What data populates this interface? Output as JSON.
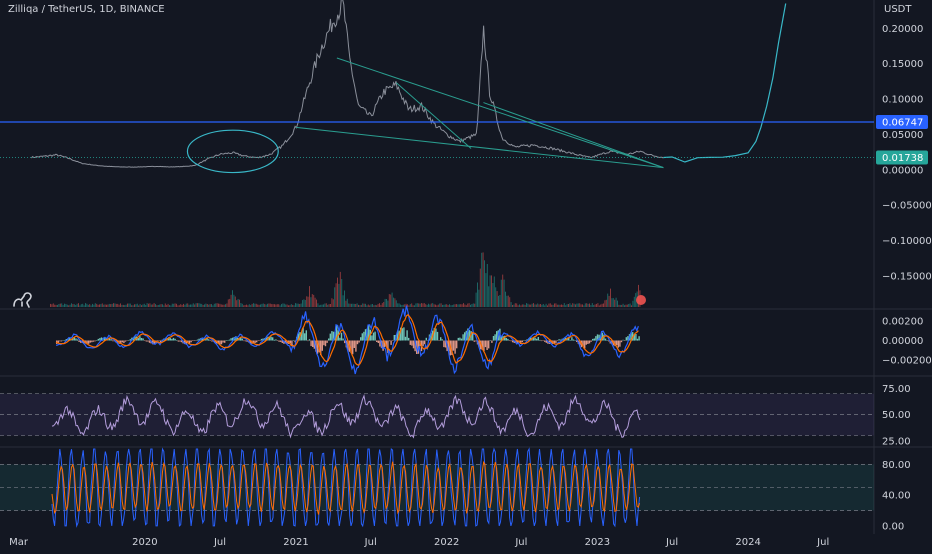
{
  "header": {
    "symbol_title": "Zilliqa / TetherUS, 1D, BINANCE",
    "price_unit": "USDT"
  },
  "colors": {
    "background": "#131722",
    "grid": "#1e222d",
    "axis_text": "#d1d4dc",
    "price_line": "#8a8f9a",
    "projection": "#39b8c8",
    "horizontal_level": "#2962ff",
    "trendline": "#2a9d8f",
    "circle": "#39b8c8",
    "volume_up": "#26a69a",
    "volume_down": "#ef5350",
    "macd_pos": "#7ad8c8",
    "macd_neg": "#f2a391",
    "macd_line": "#2962ff",
    "signal_line": "#ff6d00",
    "rsi_line": "#b39ddb",
    "rsi_band": "#7e57c2",
    "stoch_k": "#2962ff",
    "stoch_d": "#ff6d00",
    "stoch_band": "#26a69a",
    "level_label_bg": "#2962ff",
    "last_label_bg": "#26a69a"
  },
  "chart_data": {
    "type": "line",
    "x_axis": {
      "ticks": [
        "Mar",
        "2020",
        "Jul",
        "2021",
        "Jul",
        "2022",
        "Jul",
        "2023",
        "Jul",
        "2024",
        "Jul"
      ],
      "tick_dates": [
        "2019-03-01",
        "2020-01-01",
        "2020-07-01",
        "2021-01-01",
        "2021-07-01",
        "2022-01-01",
        "2022-07-01",
        "2023-01-01",
        "2023-07-01",
        "2024-01-01",
        "2024-07-01"
      ],
      "range": [
        "2019-01-15",
        "2024-11-01"
      ]
    },
    "price_panel": {
      "y_ticks": [
        "0.20000",
        "0.15000",
        "0.10000",
        "0.05000",
        "0.00000",
        "−0.05000",
        "−0.10000",
        "−0.15000"
      ],
      "y_tick_values": [
        0.2,
        0.15,
        0.1,
        0.05,
        0.0,
        -0.05,
        -0.1,
        -0.15
      ],
      "ylim": [
        -0.17,
        0.24
      ],
      "grid": false,
      "series": [
        {
          "values": [
            [
              "2019-04-01",
              0.0175
            ],
            [
              "2019-05-01",
              0.019
            ],
            [
              "2019-06-01",
              0.021
            ],
            [
              "2019-07-01",
              0.016
            ],
            [
              "2019-08-01",
              0.009
            ],
            [
              "2019-09-01",
              0.0065
            ],
            [
              "2019-10-01",
              0.0048
            ],
            [
              "2019-11-01",
              0.004
            ],
            [
              "2019-12-01",
              0.0038
            ],
            [
              "2020-01-01",
              0.0042
            ],
            [
              "2020-02-01",
              0.0048
            ],
            [
              "2020-03-01",
              0.004
            ],
            [
              "2020-04-01",
              0.0045
            ],
            [
              "2020-05-01",
              0.006
            ],
            [
              "2020-06-01",
              0.015
            ],
            [
              "2020-07-01",
              0.022
            ],
            [
              "2020-08-01",
              0.024
            ],
            [
              "2020-09-01",
              0.019
            ],
            [
              "2020-10-01",
              0.017
            ],
            [
              "2020-11-01",
              0.022
            ],
            [
              "2020-12-01",
              0.035
            ],
            [
              "2021-01-01",
              0.06
            ],
            [
              "2021-02-01",
              0.12
            ],
            [
              "2021-03-01",
              0.17
            ],
            [
              "2021-04-01",
              0.21
            ],
            [
              "2021-04-25",
              0.235
            ],
            [
              "2021-05-10",
              0.16
            ],
            [
              "2021-06-01",
              0.09
            ],
            [
              "2021-07-01",
              0.075
            ],
            [
              "2021-08-01",
              0.11
            ],
            [
              "2021-09-01",
              0.12
            ],
            [
              "2021-10-01",
              0.085
            ],
            [
              "2021-11-01",
              0.09
            ],
            [
              "2021-12-01",
              0.065
            ],
            [
              "2022-01-01",
              0.05
            ],
            [
              "2022-02-01",
              0.04
            ],
            [
              "2022-03-15",
              0.05
            ],
            [
              "2022-03-31",
              0.2
            ],
            [
              "2022-04-15",
              0.11
            ],
            [
              "2022-05-15",
              0.045
            ],
            [
              "2022-06-15",
              0.032
            ],
            [
              "2022-08-01",
              0.035
            ],
            [
              "2022-09-15",
              0.03
            ],
            [
              "2022-11-15",
              0.021
            ],
            [
              "2022-12-15",
              0.017
            ],
            [
              "2023-02-01",
              0.026
            ],
            [
              "2023-03-15",
              0.022
            ],
            [
              "2023-04-15",
              0.026
            ],
            [
              "2023-05-15",
              0.02
            ],
            [
              "2023-06-10",
              0.01738
            ]
          ]
        },
        {
          "values": [
            [
              "2023-06-10",
              0.01738
            ],
            [
              "2023-07-01",
              0.018
            ],
            [
              "2023-08-01",
              0.011
            ],
            [
              "2023-09-01",
              0.017
            ],
            [
              "2023-10-01",
              0.0175
            ],
            [
              "2023-11-01",
              0.0178
            ],
            [
              "2023-12-01",
              0.02
            ],
            [
              "2024-01-01",
              0.024
            ],
            [
              "2024-01-20",
              0.04
            ],
            [
              "2024-02-01",
              0.06
            ],
            [
              "2024-02-15",
              0.09
            ],
            [
              "2024-03-01",
              0.13
            ],
            [
              "2024-03-15",
              0.18
            ],
            [
              "2024-04-01",
              0.235
            ]
          ]
        }
      ],
      "horizontal_level": 0.06747,
      "price_labels": [
        "0.06747",
        "0.01738"
      ],
      "trendlines": [
        {
          "from": [
            "2021-04-10",
            0.158
          ],
          "to": [
            "2023-06-10",
            0.003
          ]
        },
        {
          "from": [
            "2021-01-01",
            0.06
          ],
          "to": [
            "2023-06-10",
            0.003
          ]
        },
        {
          "from": [
            "2022-03-31",
            0.095
          ],
          "to": [
            "2023-06-10",
            0.003
          ]
        },
        {
          "from": [
            "2021-09-01",
            0.123
          ],
          "to": [
            "2022-03-01",
            0.03
          ]
        }
      ],
      "ellipse": {
        "center": [
          "2020-08-01",
          0.026
        ],
        "rx_days": 110,
        "ry": 0.03
      }
    },
    "volume": {
      "spikes": [
        [
          "2020-08-01",
          0.25
        ],
        [
          "2021-02-01",
          0.35
        ],
        [
          "2021-04-15",
          0.5
        ],
        [
          "2021-08-15",
          0.25
        ],
        [
          "2022-03-31",
          1.0
        ],
        [
          "2022-04-20",
          0.55
        ],
        [
          "2022-05-15",
          0.45
        ],
        [
          "2023-02-01",
          0.3
        ],
        [
          "2023-04-15",
          0.4
        ]
      ]
    },
    "macd": {
      "y_ticks": [
        "0.00200",
        "0.00000",
        "−0.00200"
      ],
      "y_tick_values": [
        0.002,
        0.0,
        -0.002
      ],
      "ylim": [
        -0.0035,
        0.003
      ]
    },
    "rsi": {
      "y_ticks": [
        "75.00",
        "50.00",
        "25.00"
      ],
      "y_tick_values": [
        75,
        50,
        25
      ],
      "ylim": [
        20,
        85
      ],
      "band": [
        30,
        70
      ]
    },
    "stochastic": {
      "y_ticks": [
        "80.00",
        "40.00",
        "0.00"
      ],
      "y_tick_values": [
        80,
        40,
        0
      ],
      "ylim": [
        -8,
        100
      ],
      "band": [
        20,
        80
      ]
    }
  }
}
